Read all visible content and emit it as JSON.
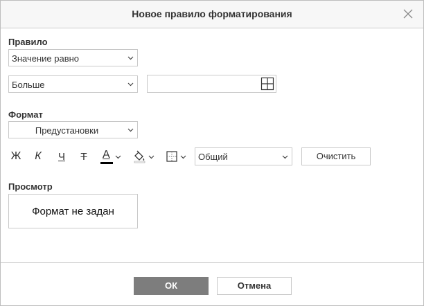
{
  "dialog": {
    "title": "Новое правило форматирования"
  },
  "rule": {
    "section_label": "Правило",
    "condition_select": "Значение равно",
    "operator_select": "Больше",
    "value_input": "",
    "value_placeholder": ""
  },
  "format": {
    "section_label": "Формат",
    "presets_select": "Предустановки",
    "bold_label": "Ж",
    "italic_label": "К",
    "underline_label": "Ч",
    "strikethrough_label": "Т",
    "font_color_label": "А",
    "font_color": "#000000",
    "number_format_select": "Общий",
    "clear_button": "Очистить"
  },
  "preview": {
    "section_label": "Просмотр",
    "text": "Формат не задан"
  },
  "footer": {
    "ok_button": "ОК",
    "cancel_button": "Отмена"
  },
  "colors": {
    "ok_background": "#7d7d7d",
    "title_background": "#f7f7f7",
    "border": "#c8c8c8"
  },
  "icons": {
    "close": "close-icon",
    "range": "range-grid-icon",
    "fill": "paint-bucket-icon",
    "borders": "borders-icon",
    "chevron": "chevron-down-icon"
  }
}
